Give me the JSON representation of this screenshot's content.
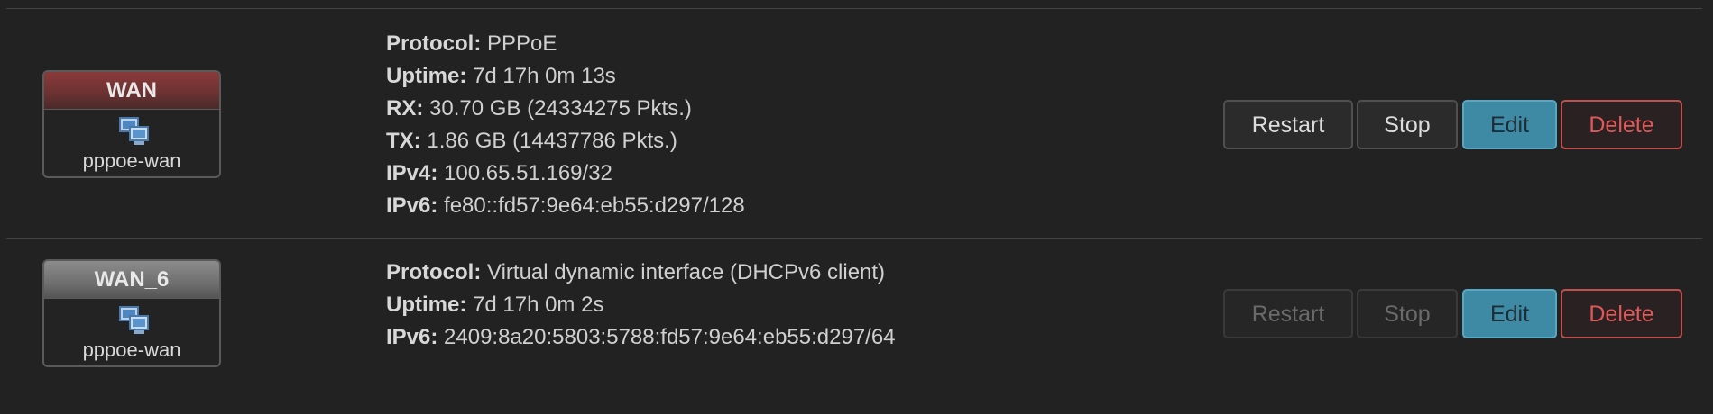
{
  "interfaces": [
    {
      "name": "WAN",
      "device": "pppoe-wan",
      "device_icon": "network-interface-icon",
      "header_color": "#7a3535",
      "info": [
        {
          "key": "Protocol:",
          "value": " PPPoE"
        },
        {
          "key": "Uptime:",
          "value": " 7d 17h 0m 13s"
        },
        {
          "key": "RX:",
          "value": " 30.70 GB (24334275 Pkts.)"
        },
        {
          "key": "TX:",
          "value": " 1.86 GB (14437786 Pkts.)"
        },
        {
          "key": "IPv4:",
          "value": " 100.65.51.169/32"
        },
        {
          "key": "IPv6:",
          "value": " fe80::fd57:9e64:eb55:d297/128"
        }
      ],
      "buttons": {
        "restart": {
          "label": "Restart",
          "enabled": true
        },
        "stop": {
          "label": "Stop",
          "enabled": true
        },
        "edit": {
          "label": "Edit",
          "enabled": true
        },
        "delete": {
          "label": "Delete",
          "enabled": true
        }
      }
    },
    {
      "name": "WAN_6",
      "device": "pppoe-wan",
      "device_icon": "network-interface-icon",
      "header_color": "#767676",
      "info": [
        {
          "key": "Protocol:",
          "value": " Virtual dynamic interface (DHCPv6 client)"
        },
        {
          "key": "Uptime:",
          "value": " 7d 17h 0m 2s"
        },
        {
          "key": "IPv6:",
          "value": " 2409:8a20:5803:5788:fd57:9e64:eb55:d297/64"
        }
      ],
      "buttons": {
        "restart": {
          "label": "Restart",
          "enabled": false
        },
        "stop": {
          "label": "Stop",
          "enabled": false
        },
        "edit": {
          "label": "Edit",
          "enabled": true
        },
        "delete": {
          "label": "Delete",
          "enabled": true
        }
      }
    }
  ],
  "colors": {
    "background": "#222222",
    "edit_button": "#3e89a3",
    "delete_accent": "#c0504d"
  }
}
